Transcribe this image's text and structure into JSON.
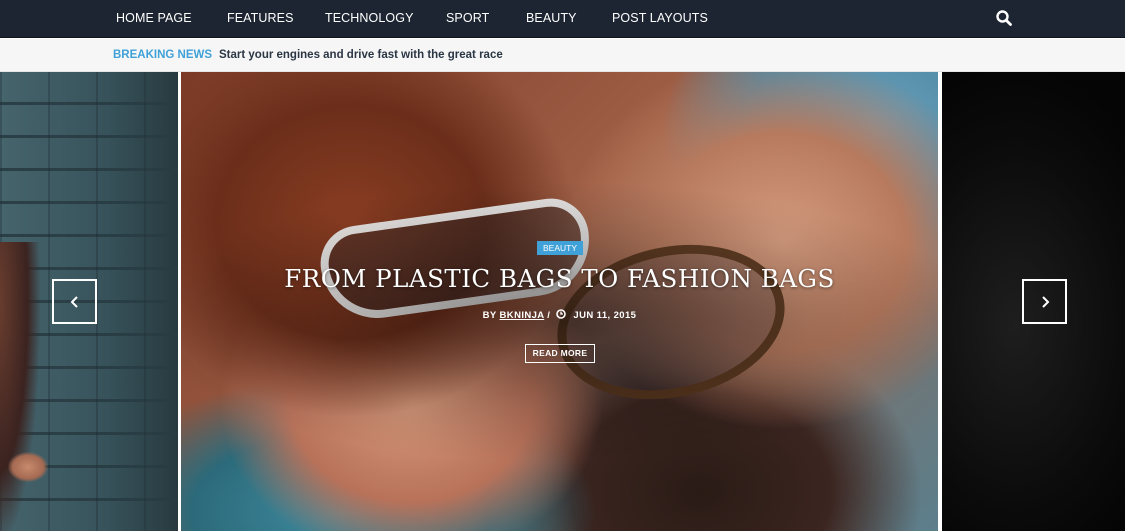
{
  "nav": {
    "items": [
      {
        "label": "HOME PAGE"
      },
      {
        "label": "FEATURES"
      },
      {
        "label": "TECHNOLOGY"
      },
      {
        "label": "SPORT"
      },
      {
        "label": "BEAUTY"
      },
      {
        "label": "POST LAYOUTS"
      }
    ],
    "search_icon": "search-icon"
  },
  "breaking_news": {
    "label": "BREAKING NEWS",
    "headline": "Start your engines and drive fast with the great race"
  },
  "slider": {
    "active_slide": {
      "category": "BEAUTY",
      "title": "FROM PLASTIC BAGS TO FASHION BAGS",
      "by_prefix": "BY",
      "author": "BKNINJA",
      "separator": "/",
      "date": "JUN 11, 2015",
      "read_more": "READ MORE"
    },
    "prev_icon": "chevron-left-icon",
    "next_icon": "chevron-right-icon"
  },
  "colors": {
    "nav_bg": "#1c2531",
    "accent": "#3fa1d8",
    "breaking_bg": "#f6f6f6"
  }
}
